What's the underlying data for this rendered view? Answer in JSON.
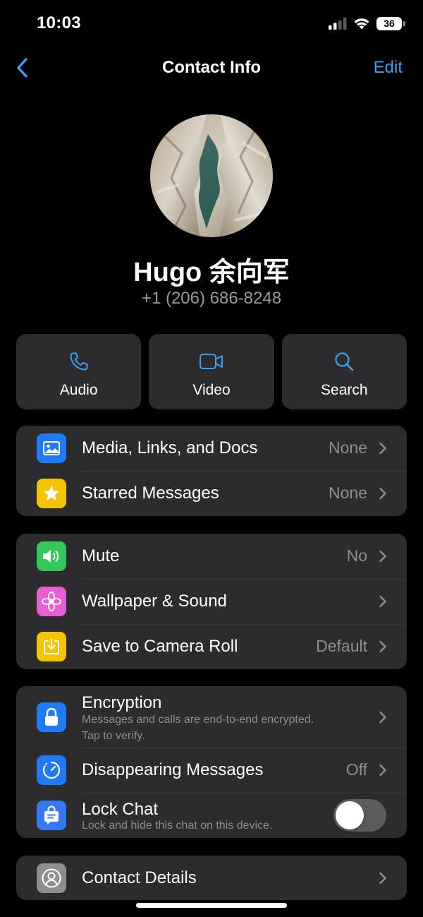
{
  "status_bar": {
    "time": "10:03",
    "battery": "36"
  },
  "nav": {
    "title": "Contact Info",
    "edit_label": "Edit"
  },
  "contact": {
    "name": "Hugo 余向军",
    "phone": "+1 (206) 686-8248"
  },
  "actions": [
    {
      "label": "Audio",
      "icon": "phone-icon"
    },
    {
      "label": "Video",
      "icon": "video-icon"
    },
    {
      "label": "Search",
      "icon": "search-icon"
    }
  ],
  "group_media": [
    {
      "label": "Media, Links, and Docs",
      "value": "None",
      "icon": "photo-icon",
      "color": "#1e7bf5"
    },
    {
      "label": "Starred Messages",
      "value": "None",
      "icon": "star-icon",
      "color": "#f5c400"
    }
  ],
  "group_settings": [
    {
      "label": "Mute",
      "value": "No",
      "icon": "speaker-icon",
      "color": "#34c759"
    },
    {
      "label": "Wallpaper & Sound",
      "value": "",
      "icon": "flower-icon",
      "color": "#e660d4"
    },
    {
      "label": "Save to Camera Roll",
      "value": "Default",
      "icon": "download-icon",
      "color": "#f5c400"
    }
  ],
  "group_privacy": {
    "encryption": {
      "label": "Encryption",
      "sub_line1": "Messages and calls are end-to-end encrypted.",
      "sub_line2": "Tap to verify.",
      "icon": "lock-icon",
      "color": "#1e7bf5"
    },
    "disappearing": {
      "label": "Disappearing Messages",
      "value": "Off",
      "icon": "timer-icon",
      "color": "#1e7bf5"
    },
    "lock_chat": {
      "label": "Lock Chat",
      "sub": "Lock and hide this chat on this device.",
      "enabled": false,
      "icon": "chat-lock-icon",
      "color": "#3478f6"
    }
  },
  "group_details": [
    {
      "label": "Contact Details",
      "icon": "person-icon",
      "color": "#8e8e93"
    }
  ],
  "colors": {
    "accent": "#3c9ef5",
    "background": "#000000",
    "cell": "#2c2c2e",
    "secondary_text": "#8e8e93"
  }
}
